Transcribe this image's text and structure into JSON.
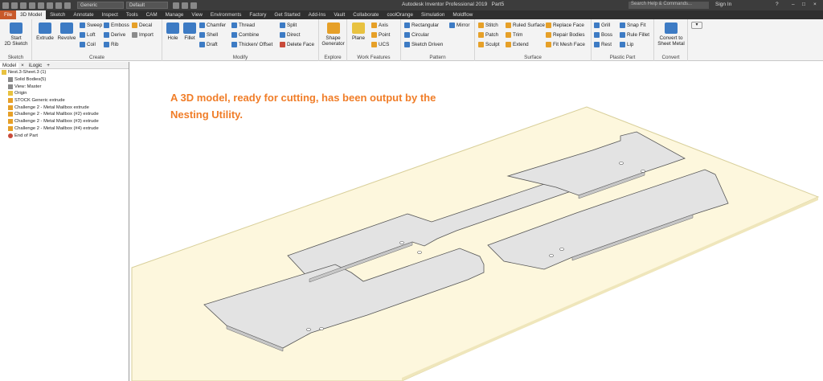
{
  "app": {
    "title": "Autodesk Inventor Professional 2019",
    "doc": "Part5",
    "search_placeholder": "Search Help & Commands...",
    "sign_in": "Sign In",
    "appearance": "Generic",
    "material": "Default"
  },
  "tabs": [
    "File",
    "3D Model",
    "Sketch",
    "Annotate",
    "Inspect",
    "Tools",
    "CAM",
    "Manage",
    "View",
    "Environments",
    "Factory",
    "Get Started",
    "Add-Ins",
    "Vault",
    "Collaborate",
    "coolOrange",
    "Simulation",
    "Moldflow"
  ],
  "ribbon": {
    "sketch": {
      "label": "Sketch",
      "start": "Start",
      "start2": "2D Sketch"
    },
    "create": {
      "label": "Create",
      "extrude": "Extrude",
      "revolve": "Revolve",
      "sweep": "Sweep",
      "loft": "Loft",
      "coil": "Coil",
      "emboss": "Emboss",
      "derive": "Derive",
      "rib": "Rib",
      "decal": "Decal",
      "import": "Import"
    },
    "modify": {
      "label": "Modify",
      "hole": "Hole",
      "fillet": "Fillet",
      "chamfer": "Chamfer",
      "shell": "Shell",
      "draft": "Draft",
      "thread": "Thread",
      "combine": "Combine",
      "thicken": "Thicken/ Offset",
      "split": "Split",
      "direct": "Direct",
      "delete_face": "Delete Face"
    },
    "explore": {
      "label": "Explore",
      "shape": "Shape",
      "shape2": "Generator"
    },
    "work": {
      "label": "Work Features",
      "plane": "Plane",
      "axis": "Axis",
      "point": "Point",
      "ucs": "UCS"
    },
    "pattern": {
      "label": "Pattern",
      "rect": "Rectangular",
      "circ": "Circular",
      "sketch": "Sketch Driven",
      "mirror": "Mirror"
    },
    "surface": {
      "label": "Surface",
      "stitch": "Stitch",
      "patch": "Patch",
      "sculpt": "Sculpt",
      "ruled": "Ruled Surface",
      "trim": "Trim",
      "extend": "Extend",
      "replace": "Replace Face",
      "repair": "Repair Bodies",
      "fitmesh": "Fit Mesh Face"
    },
    "plastic": {
      "label": "Plastic Part",
      "grill": "Grill",
      "boss": "Boss",
      "rest": "Rest",
      "snap": "Snap Fit",
      "rulefillet": "Rule Fillet",
      "lip": "Lip"
    },
    "convert": {
      "label": "Convert",
      "c1": "Convert to",
      "c2": "Sheet Metal"
    }
  },
  "browser": {
    "tab_model": "Model",
    "tab_ilogic": "iLogic",
    "items": [
      "Nest.3-Sheet.3 (1)",
      "Solid Bodies(5)",
      "View: Master",
      "Origin",
      "STOCK Generic extrude",
      "Challenge 2 - Metal Mailbox extrude",
      "Challenge 2 - Metal Mailbox (#2) extrude",
      "Challenge 2 - Metal Mailbox (#3) extrude",
      "Challenge 2 - Metal Mailbox (#4) extrude",
      "End of Part"
    ]
  },
  "caption": "A 3D model, ready for cutting, has been output by the Nesting Utility."
}
